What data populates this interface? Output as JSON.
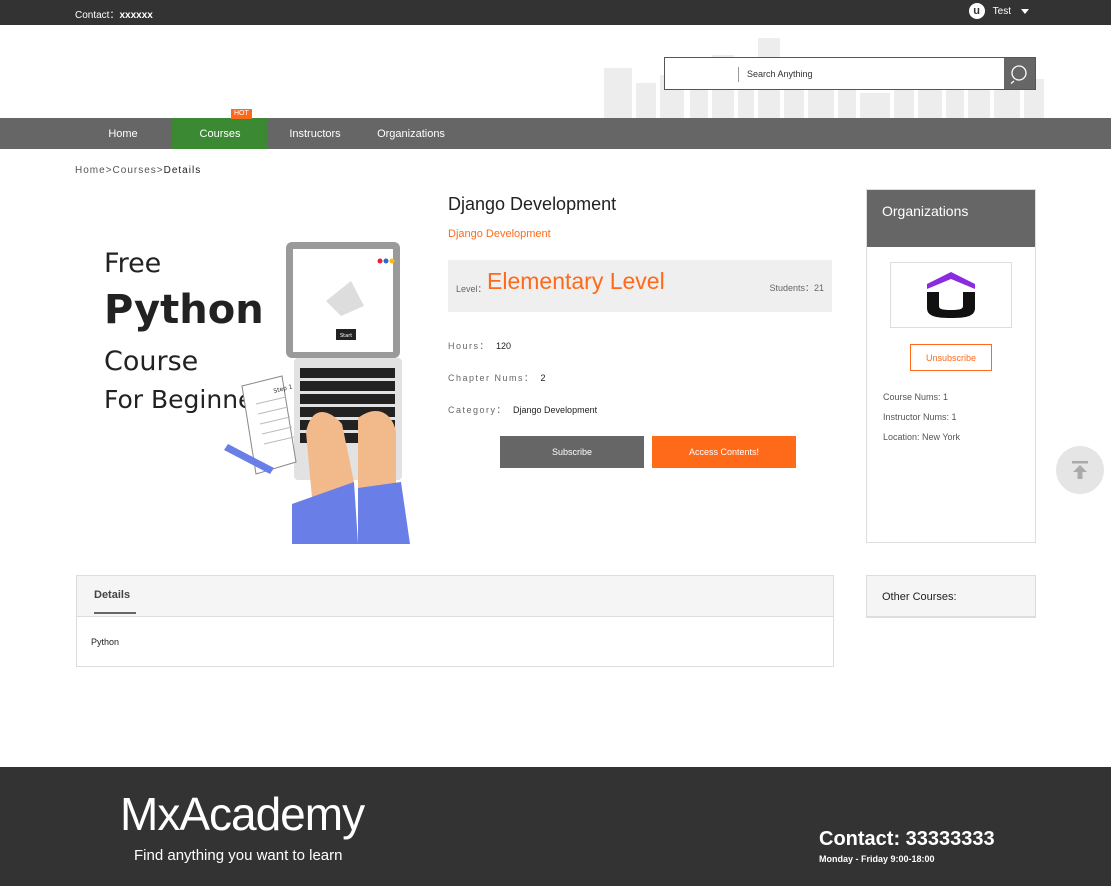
{
  "topbar": {
    "contact_label": "Contact：",
    "contact_value": "xxxxxx",
    "user_name": "Test",
    "user_icon": "u-logo-icon"
  },
  "search": {
    "placeholder": "Search Anything",
    "icon": "search-icon"
  },
  "nav": {
    "items": [
      {
        "label": "Home",
        "active": false
      },
      {
        "label": "Courses",
        "active": true,
        "badge": "HOT"
      },
      {
        "label": "Instructors",
        "active": false
      },
      {
        "label": "Organizations",
        "active": false
      }
    ]
  },
  "breadcrumb": [
    "Home",
    ">",
    "Courses",
    ">",
    "Details"
  ],
  "course": {
    "image_lines": [
      "Free",
      "Python",
      "Course",
      "For Beginners"
    ],
    "image_note": "Step 1",
    "screen_label": "Start",
    "title": "Django Development",
    "subtitle": "Django Development",
    "level_label": "Level：",
    "level_value": "Elementary Level",
    "students_label": "Students：",
    "students_value": "21",
    "hours_label": "Hours：",
    "hours_value": "120",
    "chapters_label": "Chapter Nums：",
    "chapters_value": "2",
    "category_label": "Category：",
    "category_value": "Django Development",
    "subscribe_label": "Subscribe",
    "access_label": "Access Contents!"
  },
  "organization": {
    "header": "Organizations",
    "unsubscribe_label": "Unsubscribe",
    "course_nums": "Course Nums: 1",
    "instructor_nums": "Instructor Nums: 1",
    "location": "Location: New York"
  },
  "details": {
    "tab_label": "Details",
    "content": "Python"
  },
  "other_courses": {
    "label": "Other Courses:"
  },
  "footer": {
    "brand": "MxAcademy",
    "slogan": "Find anything you want to learn",
    "contact": "Contact: 33333333",
    "hours": "Monday - Friday 9:00-18:00"
  },
  "colors": {
    "accent": "#ff6a1a",
    "nav": "#666666",
    "active_nav": "#3b8a33",
    "dark": "#333333"
  }
}
